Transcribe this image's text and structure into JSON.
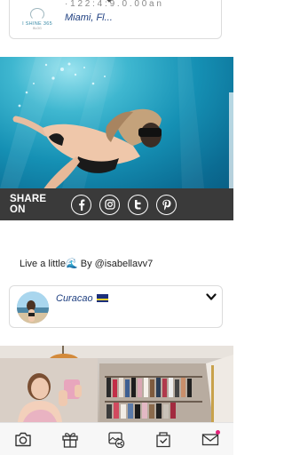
{
  "top_card": {
    "cut_text": "· 1 2 2 : 4 : 9   . 0 . 0 0 a n",
    "location": "Miami, Fl...",
    "logo_text": "I SHINE 365",
    "logo_sub": "BLOG"
  },
  "share": {
    "label": "SHARE ON",
    "icons": [
      "facebook-icon",
      "instagram-icon",
      "twitter-icon",
      "pinterest-icon"
    ]
  },
  "caption": {
    "prefix": "Live a little",
    "wave": "🌊",
    "suffix": " By @isabellavv7"
  },
  "location_card": {
    "name": "Curacao",
    "flag": "curacao-flag"
  },
  "bottom_nav": {
    "items": [
      "camera-icon",
      "gift-icon",
      "image-share-icon",
      "bag-check-icon",
      "mail-icon"
    ]
  },
  "colors": {
    "location_text": "#1e3f80",
    "share_bar": "#3a3a3a",
    "notification_dot": "#e3237a"
  }
}
